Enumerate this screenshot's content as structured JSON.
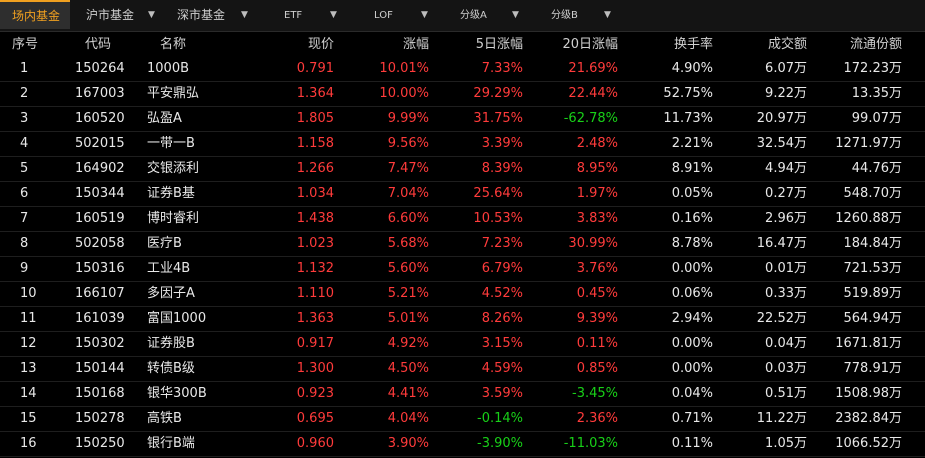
{
  "tabs": [
    {
      "label": "场内基金",
      "active": true
    },
    {
      "label": "沪市基金"
    },
    {
      "label": "深市基金"
    },
    {
      "label": "ETF"
    },
    {
      "label": "LOF"
    },
    {
      "label": "分级A"
    },
    {
      "label": "分级B"
    }
  ],
  "colors": {
    "up": "#ff3b3b",
    "down": "#18d018",
    "accent": "#f0a020"
  },
  "headers": {
    "idx": "序号",
    "code": "代码",
    "name": "名称",
    "price": "现价",
    "chg": "涨幅",
    "d5": "5日涨幅",
    "d20": "20日涨幅",
    "turn": "换手率",
    "vol": "成交额",
    "cap": "流通份额"
  },
  "rows": [
    {
      "idx": "1",
      "code": "150264",
      "name": "1000B",
      "price": "0.791",
      "chg": "10.01%",
      "d5": "7.33%",
      "d20": "21.69%",
      "turn": "4.90%",
      "vol": "6.07万",
      "cap": "172.23万"
    },
    {
      "idx": "2",
      "code": "167003",
      "name": "平安鼎弘",
      "price": "1.364",
      "chg": "10.00%",
      "d5": "29.29%",
      "d20": "22.44%",
      "turn": "52.75%",
      "vol": "9.22万",
      "cap": "13.35万"
    },
    {
      "idx": "3",
      "code": "160520",
      "name": "弘盈A",
      "price": "1.805",
      "chg": "9.99%",
      "d5": "31.75%",
      "d20": "-62.78%",
      "turn": "11.73%",
      "vol": "20.97万",
      "cap": "99.07万"
    },
    {
      "idx": "4",
      "code": "502015",
      "name": "一带一B",
      "price": "1.158",
      "chg": "9.56%",
      "d5": "3.39%",
      "d20": "2.48%",
      "turn": "2.21%",
      "vol": "32.54万",
      "cap": "1271.97万"
    },
    {
      "idx": "5",
      "code": "164902",
      "name": "交银添利",
      "price": "1.266",
      "chg": "7.47%",
      "d5": "8.39%",
      "d20": "8.95%",
      "turn": "8.91%",
      "vol": "4.94万",
      "cap": "44.76万"
    },
    {
      "idx": "6",
      "code": "150344",
      "name": "证券B基",
      "price": "1.034",
      "chg": "7.04%",
      "d5": "25.64%",
      "d20": "1.97%",
      "turn": "0.05%",
      "vol": "0.27万",
      "cap": "548.70万"
    },
    {
      "idx": "7",
      "code": "160519",
      "name": "博时睿利",
      "price": "1.438",
      "chg": "6.60%",
      "d5": "10.53%",
      "d20": "3.83%",
      "turn": "0.16%",
      "vol": "2.96万",
      "cap": "1260.88万"
    },
    {
      "idx": "8",
      "code": "502058",
      "name": "医疗B",
      "price": "1.023",
      "chg": "5.68%",
      "d5": "7.23%",
      "d20": "30.99%",
      "turn": "8.78%",
      "vol": "16.47万",
      "cap": "184.84万"
    },
    {
      "idx": "9",
      "code": "150316",
      "name": "工业4B",
      "price": "1.132",
      "chg": "5.60%",
      "d5": "6.79%",
      "d20": "3.76%",
      "turn": "0.00%",
      "vol": "0.01万",
      "cap": "721.53万"
    },
    {
      "idx": "10",
      "code": "166107",
      "name": "多因子A",
      "price": "1.110",
      "chg": "5.21%",
      "d5": "4.52%",
      "d20": "0.45%",
      "turn": "0.06%",
      "vol": "0.33万",
      "cap": "519.89万"
    },
    {
      "idx": "11",
      "code": "161039",
      "name": "富国1000",
      "price": "1.363",
      "chg": "5.01%",
      "d5": "8.26%",
      "d20": "9.39%",
      "turn": "2.94%",
      "vol": "22.52万",
      "cap": "564.94万"
    },
    {
      "idx": "12",
      "code": "150302",
      "name": "证券股B",
      "price": "0.917",
      "chg": "4.92%",
      "d5": "3.15%",
      "d20": "0.11%",
      "turn": "0.00%",
      "vol": "0.04万",
      "cap": "1671.81万"
    },
    {
      "idx": "13",
      "code": "150144",
      "name": "转债B级",
      "price": "1.300",
      "chg": "4.50%",
      "d5": "4.59%",
      "d20": "0.85%",
      "turn": "0.00%",
      "vol": "0.03万",
      "cap": "778.91万"
    },
    {
      "idx": "14",
      "code": "150168",
      "name": "银华300B",
      "price": "0.923",
      "chg": "4.41%",
      "d5": "3.59%",
      "d20": "-3.45%",
      "turn": "0.04%",
      "vol": "0.51万",
      "cap": "1508.98万"
    },
    {
      "idx": "15",
      "code": "150278",
      "name": "高铁B",
      "price": "0.695",
      "chg": "4.04%",
      "d5": "-0.14%",
      "d20": "2.36%",
      "turn": "0.71%",
      "vol": "11.22万",
      "cap": "2382.84万"
    },
    {
      "idx": "16",
      "code": "150250",
      "name": "银行B端",
      "price": "0.960",
      "chg": "3.90%",
      "d5": "-3.90%",
      "d20": "-11.03%",
      "turn": "0.11%",
      "vol": "1.05万",
      "cap": "1066.52万"
    }
  ]
}
